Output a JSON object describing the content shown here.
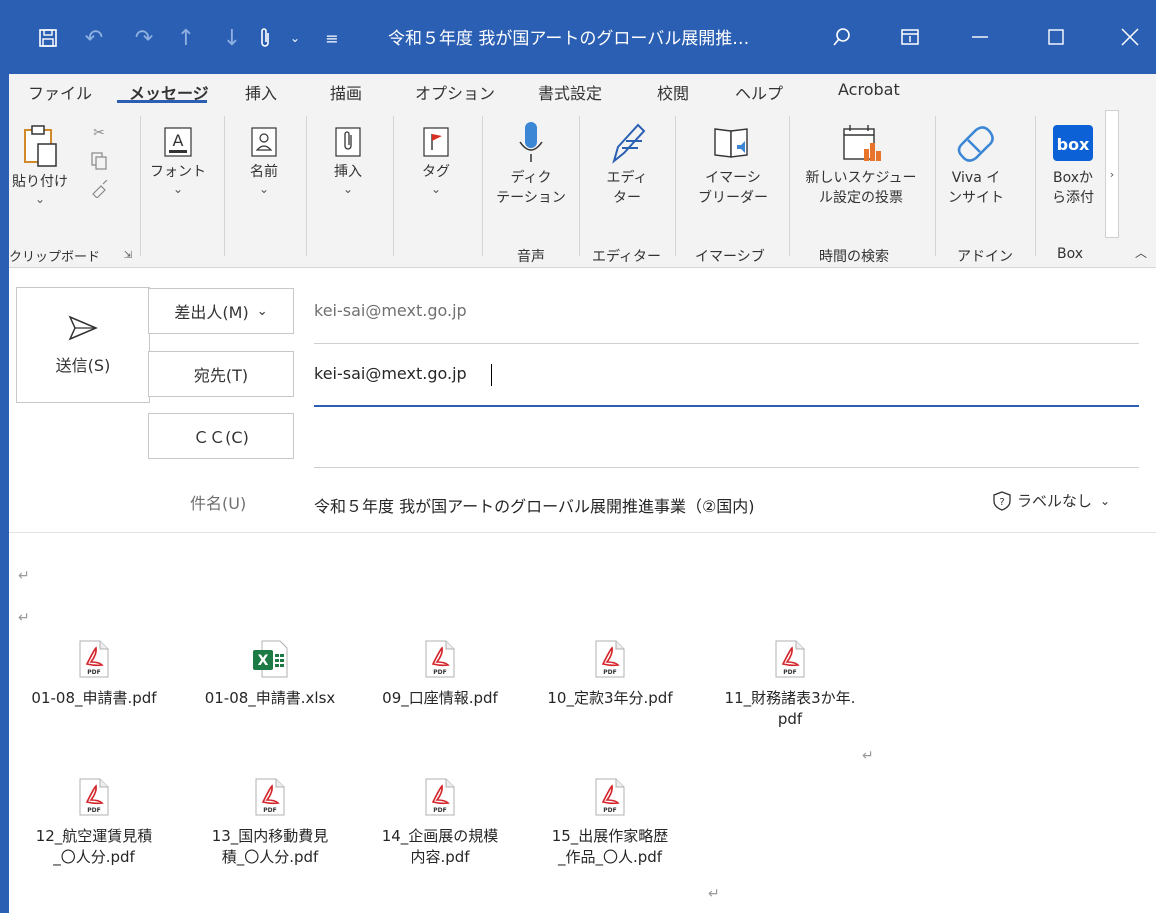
{
  "window": {
    "title": "令和５年度 我が国アートのグローバル展開推…",
    "accent_color": "#2b5fb3",
    "quick_access_icons": [
      "save-icon",
      "undo-icon",
      "redo-icon",
      "up-arrow-icon",
      "down-arrow-icon",
      "paperclip-icon",
      "dropdown-icon",
      "customize-icon"
    ],
    "controls": [
      "search-icon",
      "ribbon-display-icon",
      "minimize-icon",
      "maximize-icon",
      "close-icon"
    ]
  },
  "menu": {
    "tabs": [
      "ファイル",
      "メッセージ",
      "挿入",
      "描画",
      "オプション",
      "書式設定",
      "校閲",
      "ヘルプ",
      "Acrobat"
    ],
    "active_tab": "メッセージ"
  },
  "ribbon": {
    "paste": "貼り付け",
    "font": "フォント",
    "names": "名前",
    "insert": "挿入",
    "tags": "タグ",
    "dictate": [
      "ディク",
      "テーション"
    ],
    "editor": [
      "エディ",
      "ター"
    ],
    "immersive": [
      "イマーシ",
      "ブリーダー"
    ],
    "schedule": [
      "新しいスケジュー",
      "ル設定の投票"
    ],
    "viva": [
      "Viva イ",
      "ンサイト"
    ],
    "box": [
      "Boxか",
      "ら添付"
    ],
    "group_labels": {
      "clipboard": "クリップボード",
      "voice": "音声",
      "editor": "エディター",
      "immersive": "イマーシブ",
      "schedule": "時間の検索",
      "addin": "アドイン",
      "box": "Box"
    }
  },
  "header": {
    "send_label": "送信(S)",
    "from_label": "差出人(M)",
    "from_value": "kei-sai@mext.go.jp",
    "to_label": "宛先(T)",
    "to_value": "kei-sai@mext.go.jp",
    "cc_label": "ＣＣ(C)",
    "cc_value": "",
    "subject_label": "件名(U)",
    "subject_value": "令和５年度 我が国アートのグローバル展開推進事業（②国内)",
    "sensitivity_label": "ラベルなし"
  },
  "body": {
    "return_mark": "↵",
    "attachments_row1": [
      {
        "name": "01-08_申請書.pdf",
        "type": "pdf"
      },
      {
        "name": "01-08_申請書.xlsx",
        "type": "xlsx"
      },
      {
        "name": "09_口座情報.pdf",
        "type": "pdf"
      },
      {
        "name": "10_定款3年分.pdf",
        "type": "pdf"
      },
      {
        "name": "11_財務諸表3か年.\npdf",
        "type": "pdf"
      }
    ],
    "attachments_row2": [
      {
        "name": "12_航空運賃見積\n_〇人分.pdf",
        "type": "pdf"
      },
      {
        "name": "13_国内移動費見\n積_〇人分.pdf",
        "type": "pdf"
      },
      {
        "name": "14_企画展の規模\n内容.pdf",
        "type": "pdf"
      },
      {
        "name": "15_出展作家略歴\n_作品_〇人.pdf",
        "type": "pdf"
      }
    ]
  }
}
